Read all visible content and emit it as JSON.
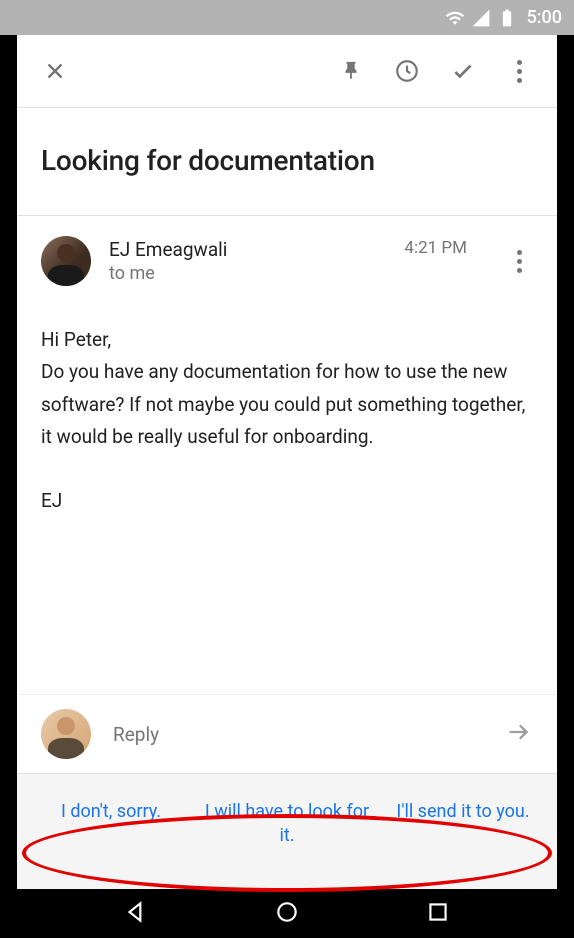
{
  "status_bar": {
    "time": "5:00"
  },
  "subject": "Looking for documentation",
  "sender": {
    "name": "EJ Emeagwali",
    "to_line": "to me"
  },
  "message": {
    "time": "4:21 PM",
    "greeting": "Hi Peter,",
    "body": "Do you have any documentation for how to use the new software? If not maybe you could put something together, it would be really useful for onboarding.",
    "signoff": "EJ"
  },
  "reply": {
    "placeholder": "Reply"
  },
  "smart_replies": {
    "r1": "I don't, sorry.",
    "r2": "I will have to look for it.",
    "r3": "I'll send it to you."
  }
}
